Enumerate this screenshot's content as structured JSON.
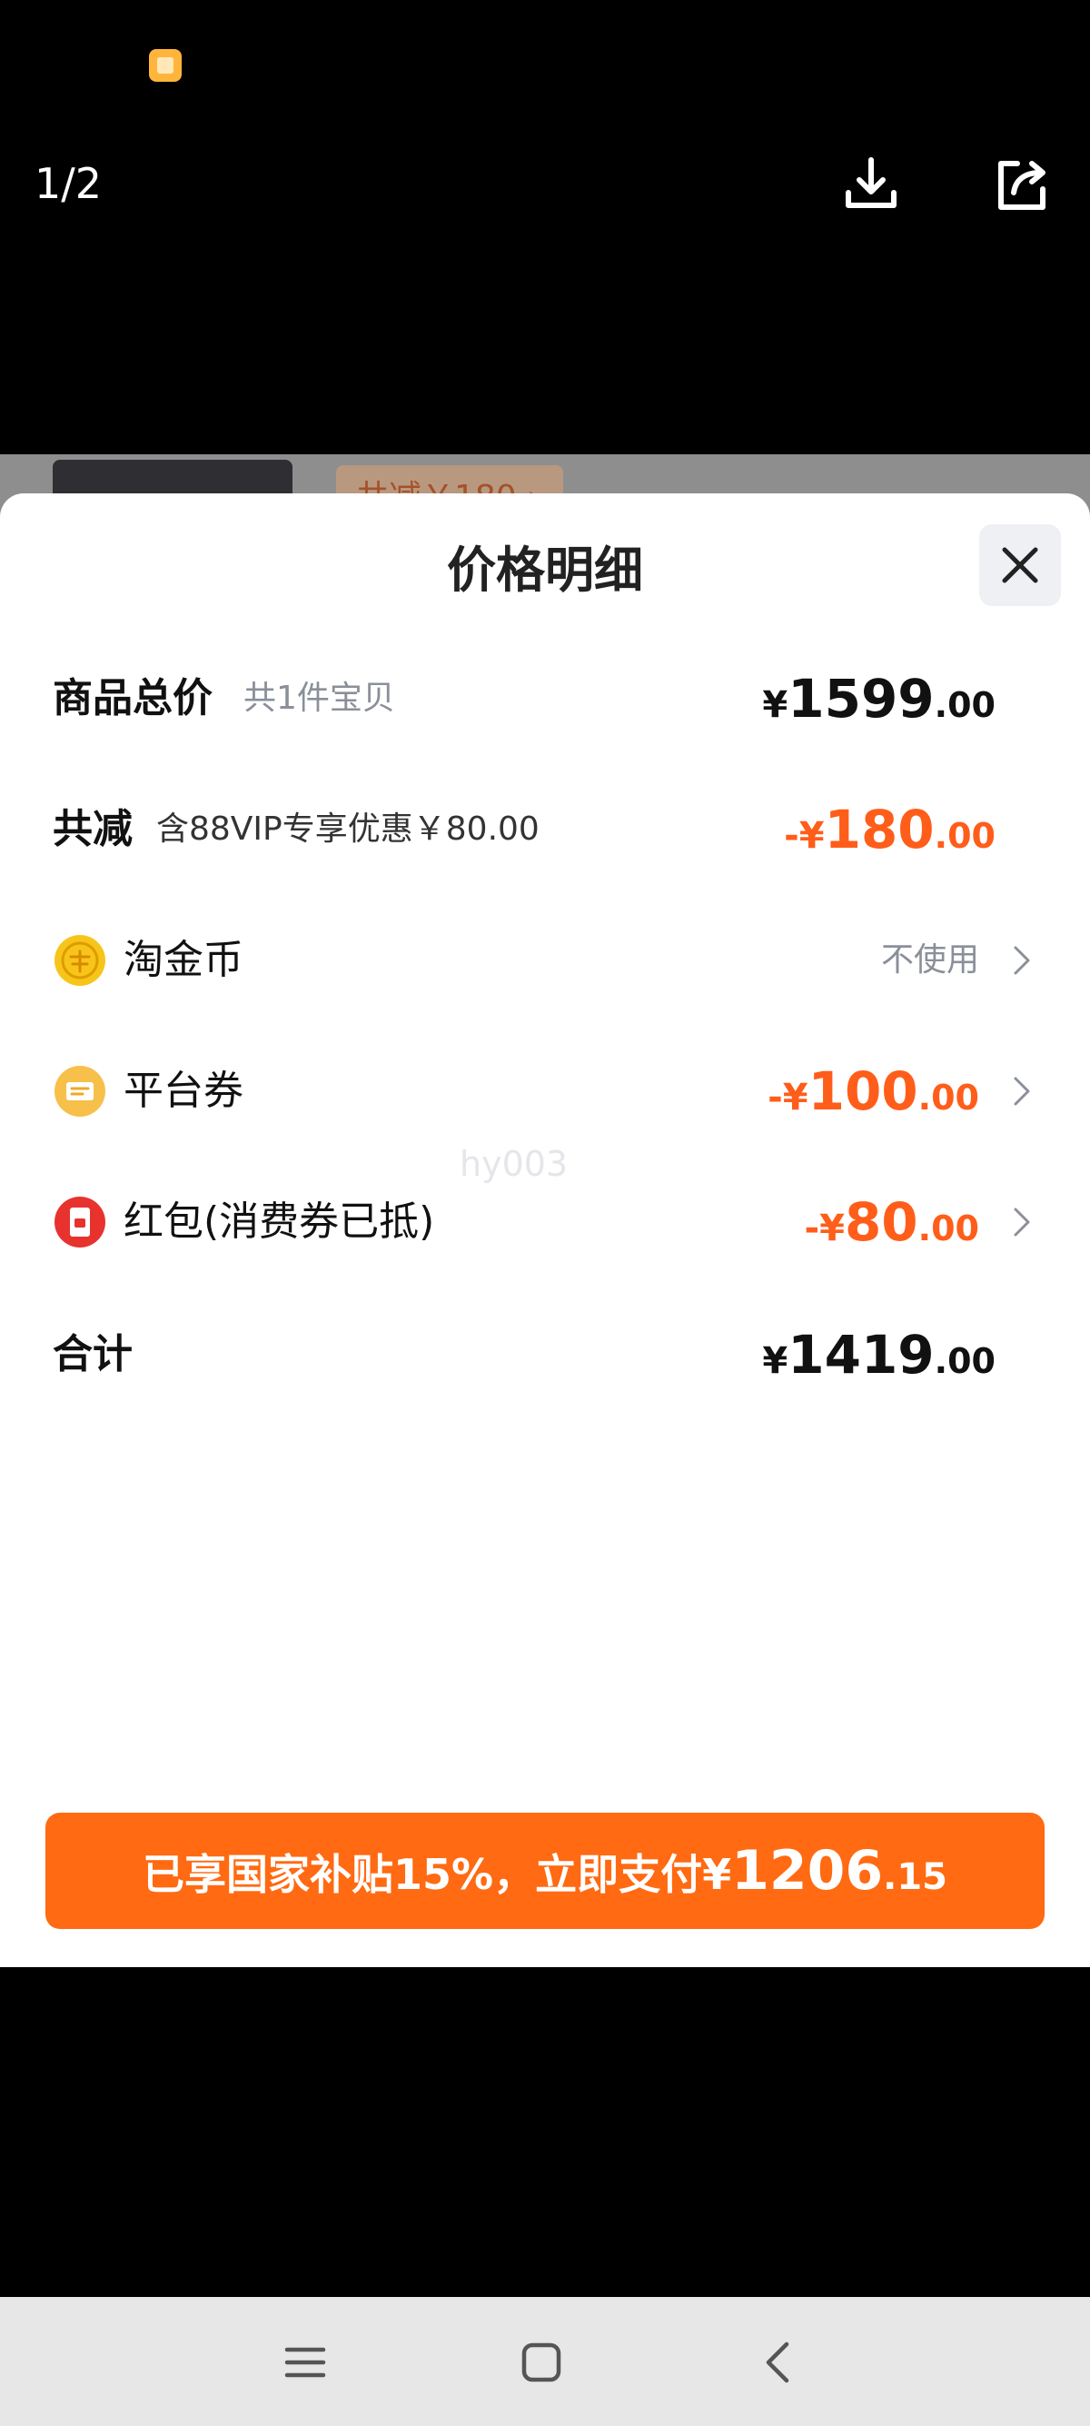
{
  "viewer": {
    "page_counter": "1/2",
    "download_icon": "download-icon",
    "share_icon": "share-icon"
  },
  "background_page": {
    "peek_text": "共减￥180 ›"
  },
  "sheet": {
    "title": "价格明细",
    "watermark": "hy003",
    "rows": [
      {
        "label": "商品总价",
        "sub": "共1件宝贝",
        "currency": "¥",
        "int": "1599",
        "dec": ".00",
        "color": "#111111"
      },
      {
        "label": "共减",
        "sub": "含88VIP专享优惠￥80.00",
        "currency": "-¥",
        "int": "180",
        "dec": ".00",
        "color": "#ff5d1a"
      },
      {
        "label": "淘金币",
        "icon": "gold-coin-icon",
        "action": "不使用"
      },
      {
        "label": "平台券",
        "icon": "coupon-icon",
        "currency": "-¥",
        "int": "100",
        "dec": ".00",
        "color": "#ff5d1a"
      },
      {
        "label": "红包(消费券已抵)",
        "icon": "red-packet-icon",
        "currency": "-¥",
        "int": "80",
        "dec": ".00",
        "color": "#ff5d1a"
      },
      {
        "label": "合计",
        "currency": "¥",
        "int": "1419",
        "dec": ".00",
        "color": "#111111"
      }
    ],
    "pay_button": {
      "text": "已享国家补贴15%，立即支付",
      "currency": "¥",
      "int": "1206",
      "dec": ".15",
      "color": "#ff6a12"
    }
  },
  "colors": {
    "accent_orange": "#ff5d1a",
    "pay_button": "#ff6a12",
    "coin_gold": "#f7c51a",
    "red_packet": "#e8322e"
  }
}
